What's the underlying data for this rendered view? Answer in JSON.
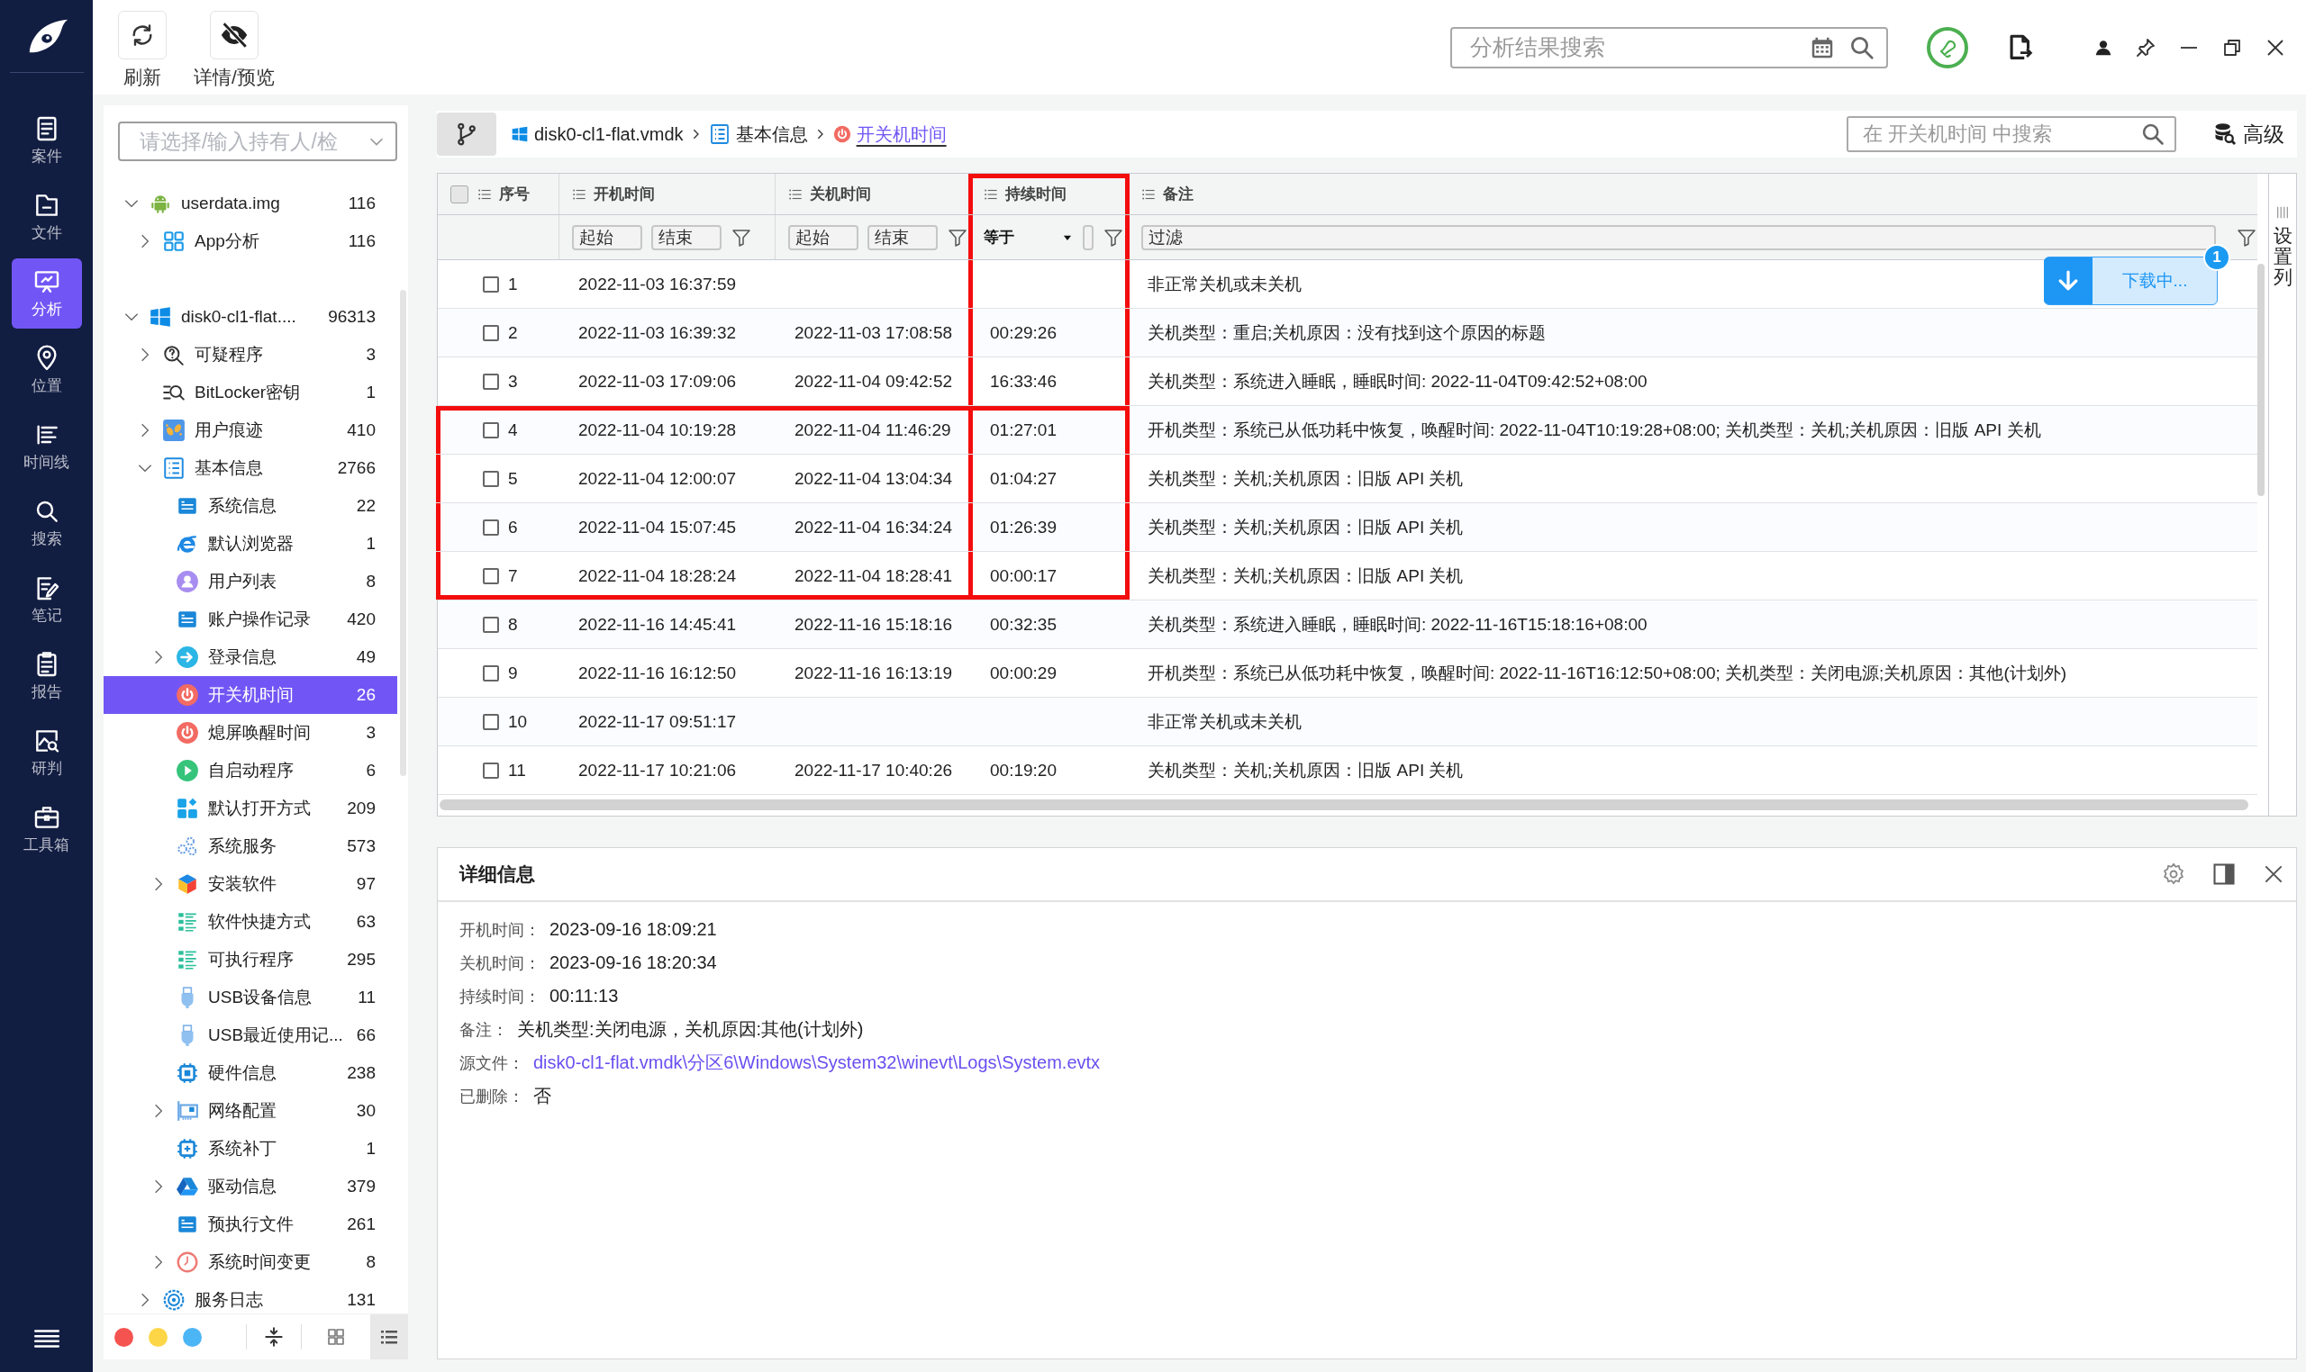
{
  "nav": {
    "items": [
      {
        "label": "案件",
        "selected": false
      },
      {
        "label": "文件",
        "selected": false
      },
      {
        "label": "分析",
        "selected": true
      },
      {
        "label": "位置",
        "selected": false
      },
      {
        "label": "时间线",
        "selected": false
      },
      {
        "label": "搜索",
        "selected": false
      },
      {
        "label": "笔记",
        "selected": false
      },
      {
        "label": "报告",
        "selected": false
      },
      {
        "label": "研判",
        "selected": false
      },
      {
        "label": "工具箱",
        "selected": false
      }
    ]
  },
  "toolbar": {
    "buttons": [
      {
        "label": "刷新"
      },
      {
        "label": "详情/预览"
      }
    ],
    "search": {
      "placeholder": "分析结果搜索"
    }
  },
  "tree": {
    "owner_select": {
      "placeholder": "请选择/输入持有人/检"
    },
    "items": [
      {
        "label": "userdata.img",
        "count": "116",
        "expanded": true,
        "selected": false,
        "children": [
          {
            "label": "App分析",
            "count": "116",
            "expanded": false,
            "selected": false
          }
        ]
      },
      {
        "label": "disk0-cl1-flat....",
        "count": "96313",
        "expanded": true,
        "selected": false,
        "children": [
          {
            "label": "可疑程序",
            "count": "3",
            "expanded": false,
            "selected": false
          },
          {
            "label": "BitLocker密钥",
            "count": "1",
            "selected": false
          },
          {
            "label": "用户痕迹",
            "count": "410",
            "expanded": false,
            "selected": false
          },
          {
            "label": "基本信息",
            "count": "2766",
            "expanded": true,
            "selected": false,
            "children": [
              {
                "label": "系统信息",
                "count": "22",
                "selected": false
              },
              {
                "label": "默认浏览器",
                "count": "1",
                "selected": false
              },
              {
                "label": "用户列表",
                "count": "8",
                "selected": false
              },
              {
                "label": "账户操作记录",
                "count": "420",
                "selected": false
              },
              {
                "label": "登录信息",
                "count": "49",
                "expanded": false,
                "selected": false
              },
              {
                "label": "开关机时间",
                "count": "26",
                "selected": true
              },
              {
                "label": "熄屏唤醒时间",
                "count": "3",
                "selected": false
              },
              {
                "label": "自启动程序",
                "count": "6",
                "selected": false
              },
              {
                "label": "默认打开方式",
                "count": "209",
                "selected": false
              },
              {
                "label": "系统服务",
                "count": "573",
                "selected": false
              },
              {
                "label": "安装软件",
                "count": "97",
                "expanded": false,
                "selected": false
              },
              {
                "label": "软件快捷方式",
                "count": "63",
                "selected": false
              },
              {
                "label": "可执行程序",
                "count": "295",
                "selected": false
              },
              {
                "label": "USB设备信息",
                "count": "11",
                "selected": false
              },
              {
                "label": "USB最近使用记...",
                "count": "66",
                "selected": false
              },
              {
                "label": "硬件信息",
                "count": "238",
                "selected": false
              },
              {
                "label": "网络配置",
                "count": "30",
                "expanded": false,
                "selected": false
              },
              {
                "label": "系统补丁",
                "count": "1",
                "selected": false
              },
              {
                "label": "驱动信息",
                "count": "379",
                "expanded": false,
                "selected": false
              },
              {
                "label": "预执行文件",
                "count": "261",
                "selected": false
              },
              {
                "label": "系统时间变更",
                "count": "8",
                "expanded": false,
                "selected": false
              }
            ]
          },
          {
            "label": "服务日志",
            "count": "131",
            "expanded": false,
            "selected": false
          }
        ]
      }
    ],
    "dots": [
      {
        "color": "#f5534f"
      },
      {
        "color": "#fdd648"
      },
      {
        "color": "#4cb5f5"
      }
    ],
    "view_modes": [
      {
        "selected": false
      },
      {
        "selected": true
      }
    ]
  },
  "breadcrumb": [
    {
      "label": "disk0-cl1-flat.vmdk",
      "kind": "disk"
    },
    {
      "label": "基本信息",
      "kind": "folder"
    },
    {
      "label": "开关机时间",
      "kind": "current"
    }
  ],
  "table_search": {
    "placeholder": "在 开关机时间 中搜索"
  },
  "advanced": "高级",
  "download": {
    "label": "下载中...",
    "count": "1"
  },
  "table": {
    "select_all": false,
    "settings_label": "设置列",
    "columns": [
      {
        "label": "序号",
        "kind": "index",
        "marked": false
      },
      {
        "label": "开机时间",
        "kind": "range",
        "filters": [
          {
            "placeholder": "起始"
          },
          {
            "placeholder": "结束"
          }
        ],
        "marked": false
      },
      {
        "label": "关机时间",
        "kind": "range",
        "filters": [
          {
            "placeholder": "起始"
          },
          {
            "placeholder": "结束"
          }
        ],
        "marked": false
      },
      {
        "label": "持续时间",
        "kind": "compare",
        "operator": "等于",
        "marked": true
      },
      {
        "label": "备注",
        "kind": "text",
        "placeholder": "过滤",
        "marked": false
      }
    ],
    "rows": [
      {
        "no": "1",
        "open": "2022-11-03 16:37:59",
        "note": "非正常关机或未关机",
        "checked": false,
        "marked": false
      },
      {
        "no": "2",
        "open": "2022-11-03 16:39:32",
        "close": "2022-11-03 17:08:58",
        "duration": "00:29:26",
        "note": "关机类型：重启;关机原因：没有找到这个原因的标题",
        "checked": false,
        "marked": false
      },
      {
        "no": "3",
        "open": "2022-11-03 17:09:06",
        "close": "2022-11-04 09:42:52",
        "duration": "16:33:46",
        "note": "关机类型：系统进入睡眠，睡眠时间: 2022-11-04T09:42:52+08:00",
        "checked": false,
        "marked": false
      },
      {
        "no": "4",
        "open": "2022-11-04 10:19:28",
        "close": "2022-11-04 11:46:29",
        "duration": "01:27:01",
        "note": "开机类型：系统已从低功耗中恢复，唤醒时间: 2022-11-04T10:19:28+08:00; 关机类型：关机;关机原因：旧版 API 关机",
        "checked": false,
        "marked": true
      },
      {
        "no": "5",
        "open": "2022-11-04 12:00:07",
        "close": "2022-11-04 13:04:34",
        "duration": "01:04:27",
        "note": "关机类型：关机;关机原因：旧版 API 关机",
        "checked": false,
        "marked": true
      },
      {
        "no": "6",
        "open": "2022-11-04 15:07:45",
        "close": "2022-11-04 16:34:24",
        "duration": "01:26:39",
        "note": "关机类型：关机;关机原因：旧版 API 关机",
        "checked": false,
        "marked": true
      },
      {
        "no": "7",
        "open": "2022-11-04 18:28:24",
        "close": "2022-11-04 18:28:41",
        "duration": "00:00:17",
        "note": "关机类型：关机;关机原因：旧版 API 关机",
        "checked": false,
        "marked": true
      },
      {
        "no": "8",
        "open": "2022-11-16 14:45:41",
        "close": "2022-11-16 15:18:16",
        "duration": "00:32:35",
        "note": "关机类型：系统进入睡眠，睡眠时间: 2022-11-16T15:18:16+08:00",
        "checked": false,
        "marked": false
      },
      {
        "no": "9",
        "open": "2022-11-16 16:12:50",
        "close": "2022-11-16 16:13:19",
        "duration": "00:00:29",
        "note": "开机类型：系统已从低功耗中恢复，唤醒时间: 2022-11-16T16:12:50+08:00; 关机类型：关闭电源;关机原因：其他(计划外)",
        "checked": false,
        "marked": false
      },
      {
        "no": "10",
        "open": "2022-11-17 09:51:17",
        "note": "非正常关机或未关机",
        "checked": false,
        "marked": false
      },
      {
        "no": "11",
        "open": "2022-11-17 10:21:06",
        "close": "2022-11-17 10:40:26",
        "duration": "00:19:20",
        "note": "关机类型：关机;关机原因：旧版 API 关机",
        "checked": false,
        "marked": false
      }
    ]
  },
  "detail": {
    "title": "详细信息",
    "fields": [
      {
        "label": "开机时间：",
        "value": "2023-09-16 18:09:21",
        "kind": "text"
      },
      {
        "label": "关机时间：",
        "value": "2023-09-16 18:20:34",
        "kind": "text"
      },
      {
        "label": "持续时间：",
        "value": "00:11:13",
        "kind": "text"
      },
      {
        "label": "备注：",
        "value": "关机类型:关闭电源，关机原因:其他(计划外)",
        "kind": "text"
      },
      {
        "label": "源文件：",
        "value": "disk0-cl1-flat.vmdk\\分区6\\Windows\\System32\\winevt\\Logs\\System.evtx",
        "kind": "link"
      },
      {
        "label": "已删除：",
        "value": "否",
        "kind": "text"
      }
    ]
  }
}
